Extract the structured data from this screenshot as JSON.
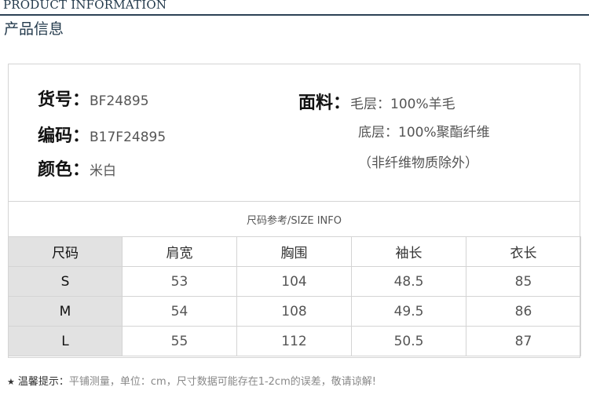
{
  "header": {
    "title_en": "PRODUCT INFORMATION",
    "title_cn": "产品信息"
  },
  "product": {
    "item_no_label": "货号：",
    "item_no": "BF24895",
    "code_label": "编码：",
    "code": "B17F24895",
    "color_label": "颜色：",
    "color": "米白",
    "fabric_label": "面料：",
    "fabric_lines": [
      "毛层：100%羊毛",
      "底层：100%聚酯纤维",
      "（非纤维物质除外）"
    ]
  },
  "size_info": {
    "caption": "尺码参考/SIZE INFO",
    "headers": [
      "尺码",
      "肩宽",
      "胸围",
      "袖长",
      "衣长"
    ],
    "rows": [
      [
        "S",
        "53",
        "104",
        "48.5",
        "85"
      ],
      [
        "M",
        "54",
        "108",
        "49.5",
        "86"
      ],
      [
        "L",
        "55",
        "112",
        "50.5",
        "87"
      ]
    ]
  },
  "note": {
    "star": "★",
    "label": "温馨提示：",
    "text": "平铺测量，单位：cm，尺寸数据可能存在1-2cm的误差，敬请谅解!"
  }
}
